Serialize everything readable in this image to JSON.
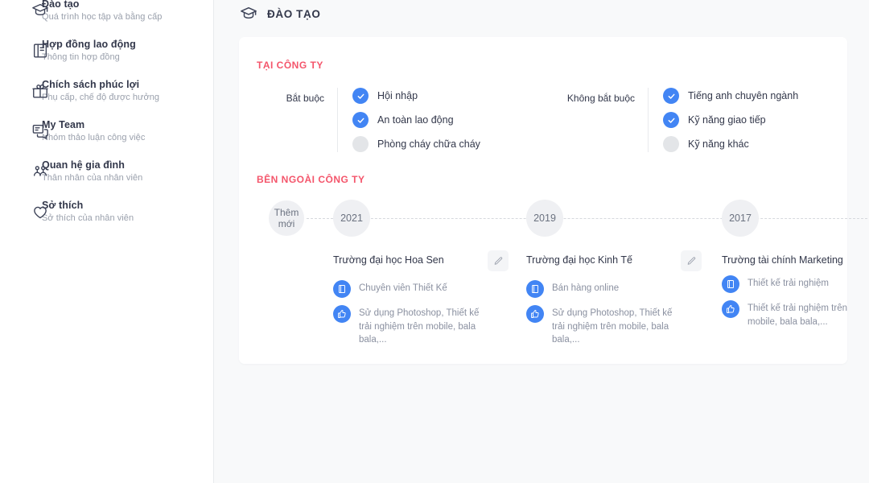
{
  "sidebar": {
    "items": [
      {
        "icon": "graduation-cap-icon",
        "title": "Đào tạo",
        "sub": "Quá trình học tập và bằng cấp"
      },
      {
        "icon": "contract-book-icon",
        "title": "Hợp đồng lao động",
        "sub": "Thông tin hợp đồng"
      },
      {
        "icon": "gift-icon",
        "title": "Chích sách phúc lợi",
        "sub": "Phụ cấp, chế độ được hưởng"
      },
      {
        "icon": "chat-team-icon",
        "title": "My Team",
        "sub": "Nhóm thảo luận công việc"
      },
      {
        "icon": "people-group-icon",
        "title": "Quan hệ gia đình",
        "sub": "Thân nhân của nhân viên"
      },
      {
        "icon": "heart-icon",
        "title": "Sở thích",
        "sub": "Sở thích của nhân viên"
      }
    ]
  },
  "header": {
    "icon": "graduation-cap-icon",
    "title": "ĐÀO TẠO"
  },
  "company_section": {
    "label": "TẠI CÔNG TY",
    "groups": [
      {
        "label": "Bắt buộc",
        "options": [
          {
            "label": "Hội nhập",
            "checked": true
          },
          {
            "label": "An toàn lao động",
            "checked": true
          },
          {
            "label": "Phòng cháy chữa cháy",
            "checked": false
          }
        ]
      },
      {
        "label": "Không bắt buộc",
        "options": [
          {
            "label": "Tiếng anh chuyên ngành",
            "checked": true
          },
          {
            "label": "Kỹ năng giao tiếp",
            "checked": true
          },
          {
            "label": "Kỹ năng khác",
            "checked": false
          }
        ]
      }
    ]
  },
  "outside_section": {
    "label": "BÊN NGOÀI CÔNG TY",
    "add_node": {
      "line1": "Thêm",
      "line2": "mới"
    },
    "entries": [
      {
        "year": "2021",
        "school": "Trường đại học Hoa Sen",
        "edit_label": "pencil-icon",
        "rows": [
          {
            "icon": "book-icon",
            "text": "Chuyên viên Thiết Kế"
          },
          {
            "icon": "thumbs-up-icon",
            "text": "Sử dụng Photoshop, Thiết kế trải nghiệm trên mobile, bala bala,..."
          }
        ]
      },
      {
        "year": "2019",
        "school": "Trường đại học Kinh Tế",
        "edit_label": "pencil-icon",
        "rows": [
          {
            "icon": "book-icon",
            "text": "Bán hàng online"
          },
          {
            "icon": "thumbs-up-icon",
            "text": "Sử dụng Photoshop, Thiết kế trải nghiệm trên mobile, bala bala,..."
          }
        ]
      },
      {
        "year": "2017",
        "school": "Trường tài chính Marketing",
        "edit_label": "pencil-icon",
        "rows": [
          {
            "icon": "book-icon",
            "text": "Thiết kế trải nghiệm"
          },
          {
            "icon": "thumbs-up-icon",
            "text": "Thiết kế trải nghiệm trên mobile, bala bala,..."
          }
        ]
      }
    ]
  },
  "colors": {
    "accent_red": "#f4556b",
    "accent_blue": "#4285f4",
    "page_bg": "#f8f9fa",
    "card_bg": "#ffffff",
    "node_bg": "#eff0f3"
  }
}
